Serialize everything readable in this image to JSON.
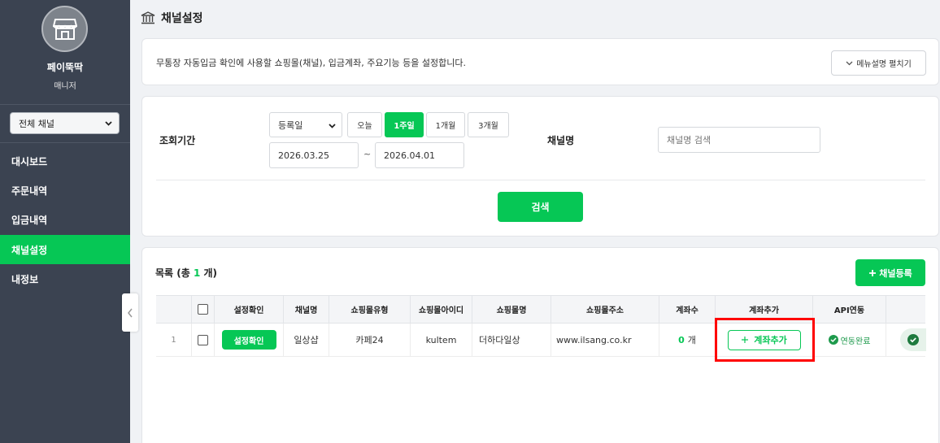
{
  "sidebar": {
    "brand": "페이뚝딱",
    "role": "매니저",
    "channel_select": "전체 채널",
    "items": [
      {
        "label": "대시보드"
      },
      {
        "label": "주문내역"
      },
      {
        "label": "입금내역"
      },
      {
        "label": "채널설정"
      },
      {
        "label": "내정보"
      }
    ],
    "active": "채널설정"
  },
  "page": {
    "title": "채널설정",
    "description": "무통장 자동입금 확인에 사용할 쇼핑몰(채널), 입금계좌, 주요기능 등을 설정합니다.",
    "menu_desc_btn": "메뉴설명 펼치기"
  },
  "filter": {
    "period_label": "조회기간",
    "date_type": "등록일",
    "period_buttons": [
      "오늘",
      "1주일",
      "1개월",
      "3개월"
    ],
    "active_period": "1주일",
    "date_from": "2026.03.25",
    "date_sep": "~",
    "date_to": "2026.04.01",
    "channel_label": "채널명",
    "channel_placeholder": "채널명 검색",
    "search_btn": "검색"
  },
  "list": {
    "title_prefix": "목록 (총 ",
    "count": "1",
    "title_suffix": " 개)",
    "add_btn": "채널등록",
    "columns": [
      "설정확인",
      "채널명",
      "쇼핑몰유형",
      "쇼핑몰아이디",
      "쇼핑몰명",
      "쇼핑몰주소",
      "계좌수",
      "계좌추가",
      "API연동"
    ],
    "rows": [
      {
        "no": "1",
        "confirm": "설정확인",
        "channel": "일상샵",
        "mall_type": "카페24",
        "mall_id": "kultem",
        "mall_name": "더하다일상",
        "mall_url": "www.ilsang.co.kr",
        "account_count": "0",
        "account_unit": "개",
        "add_account": "계좌추가",
        "api_status": "연동완료"
      }
    ]
  },
  "colors": {
    "accent": "#06c755",
    "sidebar": "#3b4351",
    "highlight": "#ff0000"
  }
}
